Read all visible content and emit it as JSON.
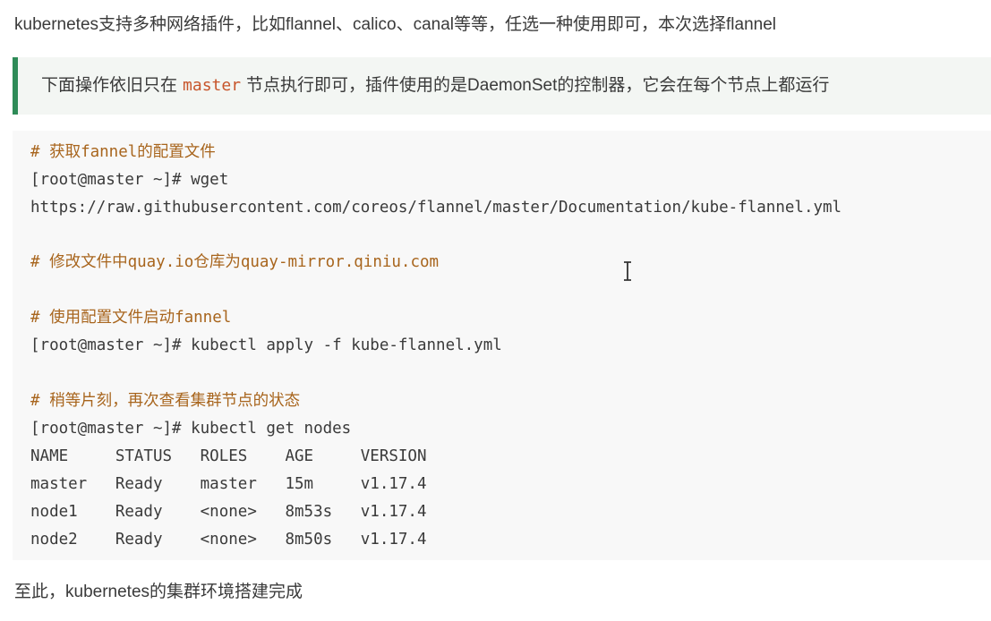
{
  "intro_text": "kubernetes支持多种网络插件，比如flannel、calico、canal等等，任选一种使用即可，本次选择flannel",
  "note": {
    "before": "下面操作依旧只在",
    "code": "master",
    "after": "节点执行即可，插件使用的是DaemonSet的控制器，它会在每个节点上都运行"
  },
  "code": {
    "comment1": "# 获取fannel的配置文件",
    "prompt1": "[root@master ~]# wget",
    "url": "https://raw.githubusercontent.com/coreos/flannel/master/Documentation/kube-flannel.yml",
    "comment2": "# 修改文件中quay.io仓库为quay-mirror.qiniu.com",
    "comment3": "# 使用配置文件启动fannel",
    "prompt2": "[root@master ~]# kubectl apply -f kube-flannel.yml",
    "comment4": "# 稍等片刻，再次查看集群节点的状态",
    "prompt3": "[root@master ~]# kubectl get nodes",
    "table_header": "NAME     STATUS   ROLES    AGE     VERSION",
    "rows": [
      "master   Ready    master   15m     v1.17.4",
      "node1    Ready    <none>   8m53s   v1.17.4",
      "node2    Ready    <none>   8m50s   v1.17.4"
    ]
  },
  "outro_text": "至此，kubernetes的集群环境搭建完成",
  "colors": {
    "note_border": "#2e8b57",
    "inline_code": "#c7552b",
    "comment": "#a8651d",
    "code_bg": "#f8f8f8"
  },
  "icons": {
    "cursor": "text-cursor-icon"
  }
}
